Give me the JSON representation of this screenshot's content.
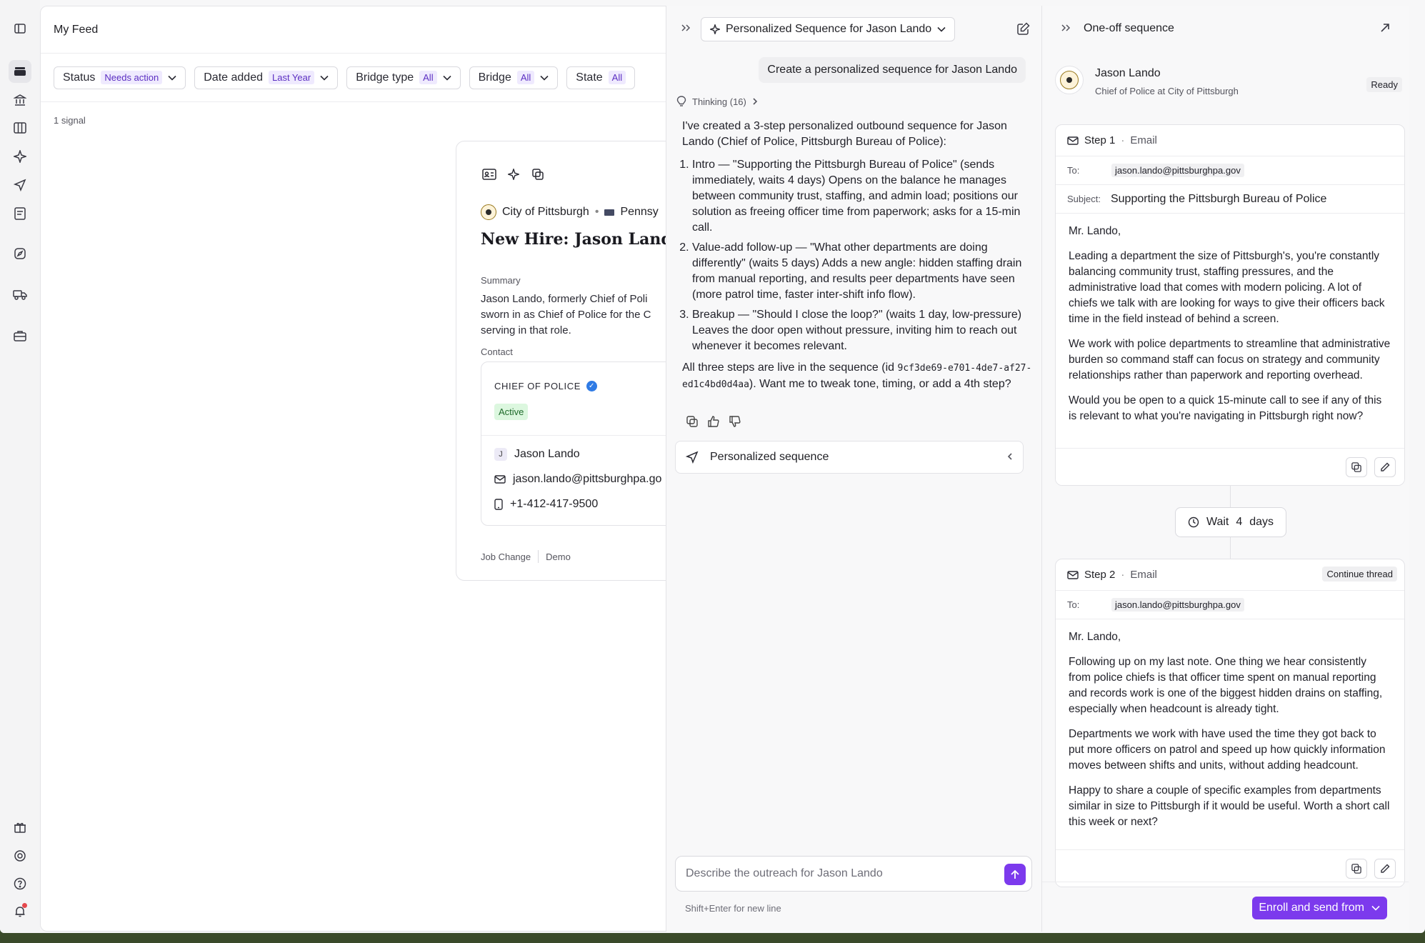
{
  "feed": {
    "title": "My Feed",
    "filters": [
      {
        "label": "Status",
        "value": "Needs action"
      },
      {
        "label": "Date added",
        "value": "Last Year"
      },
      {
        "label": "Bridge type",
        "value": "All"
      },
      {
        "label": "Bridge",
        "value": "All"
      },
      {
        "label": "State",
        "value": "All"
      }
    ],
    "signal_count": "1 signal",
    "card": {
      "org": "City of Pittsburgh",
      "region": "Pennsy",
      "title": "New Hire: Jason Lando",
      "summary_label": "Summary",
      "summary_lines": [
        "Jason Lando, formerly Chief of Poli",
        "sworn in as Chief of Police for the C",
        "serving in that role."
      ],
      "contact_label": "Contact",
      "role": "CHIEF OF POLICE",
      "status": "Active",
      "initial": "J",
      "name": "Jason Lando",
      "email": "jason.lando@pittsburghpa.go",
      "phone": "+1-412-417-9500",
      "tags": [
        "Job Change",
        "Demo"
      ]
    }
  },
  "chat": {
    "title": "Personalized Sequence for Jason Lando",
    "user_message": "Create a personalized sequence for Jason Lando",
    "thinking": "Thinking (16)",
    "intro": "I've created a 3-step personalized outbound sequence for Jason Lando (Chief of Police, Pittsburgh Bureau of Police):",
    "steps": [
      "Intro — \"Supporting the Pittsburgh Bureau of Police\" (sends immediately, waits 4 days) Opens on the balance he manages between community trust, staffing, and admin load; positions our solution as freeing officer time from paperwork; asks for a 15-min call.",
      "Value-add follow-up — \"What other departments are doing differently\" (waits 5 days) Adds a new angle: hidden staffing drain from manual reporting, and results peer departments have seen (more patrol time, faster inter-shift info flow).",
      "Breakup — \"Should I close the loop?\" (waits 1 day, low-pressure) Leaves the door open without pressure, inviting him to reach out whenever it becomes relevant."
    ],
    "outro_before": "All three steps are live in the sequence (id ",
    "sequence_id": "9cf3de69-e701-4de7-af27-ed1c4bd0d4aa",
    "outro_after": "). Want me to tweak tone, timing, or add a 4th step?",
    "sequence_row": "Personalized sequence",
    "compose_placeholder": "Describe the outreach for Jason Lando",
    "hint": "Shift+Enter for new line"
  },
  "sequence": {
    "title": "One-off sequence",
    "person_name": "Jason Lando",
    "person_role": "Chief of Police at City of Pittsburgh",
    "status": "Ready",
    "step1": {
      "label": "Step 1",
      "type": "Email",
      "to_label": "To:",
      "to": "jason.lando@pittsburghpa.gov",
      "subject_label": "Subject:",
      "subject": "Supporting the Pittsburgh Bureau of Police",
      "paragraphs": [
        "Mr. Lando,",
        "Leading a department the size of Pittsburgh's, you're constantly balancing community trust, staffing pressures, and the administrative load that comes with modern policing. A lot of chiefs we talk with are looking for ways to give their officers back time in the field instead of behind a screen.",
        "We work with police departments to streamline that administrative burden so command staff can focus on strategy and community relationships rather than paperwork and reporting overhead.",
        "Would you be open to a quick 15-minute call to see if any of this is relevant to what you're navigating in Pittsburgh right now?"
      ]
    },
    "wait": {
      "label": "Wait",
      "value": "4",
      "unit": "days"
    },
    "step2": {
      "label": "Step 2",
      "type": "Email",
      "badge": "Continue thread",
      "to_label": "To:",
      "to": "jason.lando@pittsburghpa.gov",
      "paragraphs": [
        "Mr. Lando,",
        "Following up on my last note. One thing we hear consistently from police chiefs is that officer time spent on manual reporting and records work is one of the biggest hidden drains on staffing, especially when headcount is already tight.",
        "Departments we work with have used the time they got back to put more officers on patrol and speed up how quickly information moves between shifts and units, without adding headcount.",
        "Happy to share a couple of specific examples from departments similar in size to Pittsburgh if it would be useful. Worth a short call this week or next?"
      ]
    },
    "enroll_label": "Enroll and send from"
  }
}
